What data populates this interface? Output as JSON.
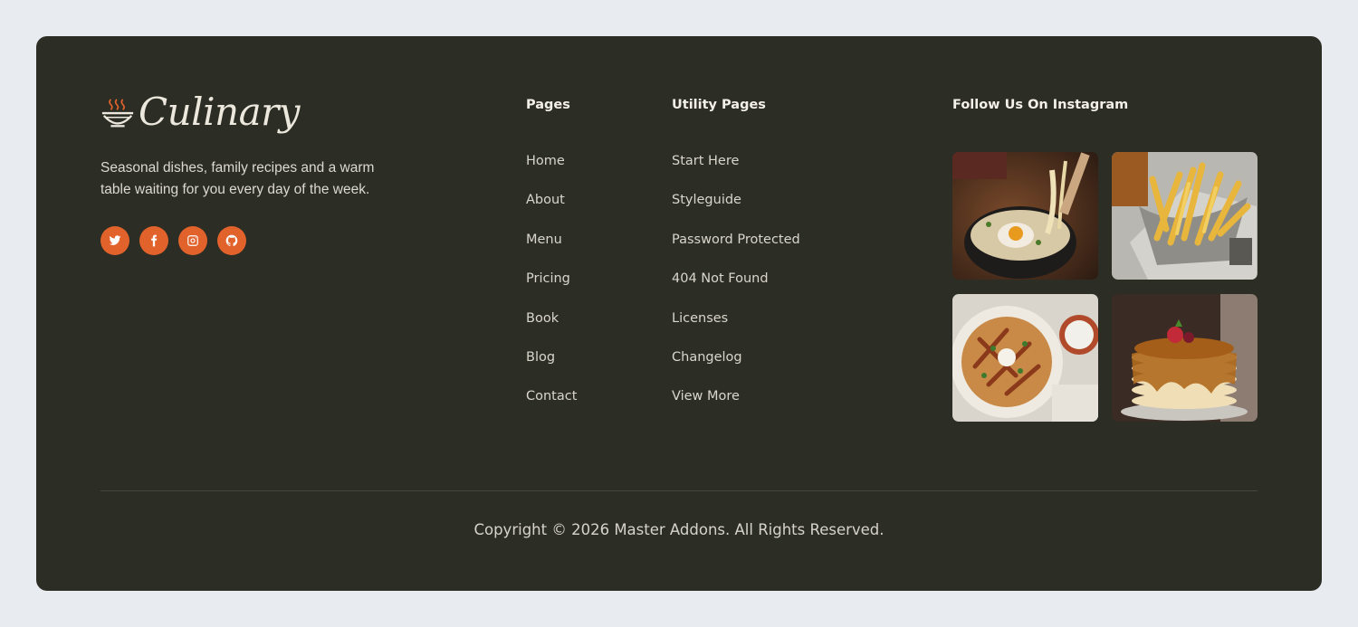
{
  "brand": {
    "name": "Culinary",
    "tagline": "Seasonal dishes, family recipes and a warm table waiting for you every day of the week."
  },
  "socials": [
    {
      "icon": "twitter-icon"
    },
    {
      "icon": "facebook-icon"
    },
    {
      "icon": "instagram-icon"
    },
    {
      "icon": "github-icon"
    }
  ],
  "pages": {
    "title": "Pages",
    "links": [
      "Home",
      "About",
      "Menu",
      "Pricing",
      "Book",
      "Blog",
      "Contact"
    ]
  },
  "utility": {
    "title": "Utility Pages",
    "links": [
      "Start Here",
      "Styleguide",
      "Password Protected",
      "404 Not Found",
      "Licenses",
      "Changelog",
      "View More"
    ]
  },
  "instagram": {
    "title": "Follow Us On Instagram"
  },
  "copyright": "Copyright © 2026 Master Addons. All Rights Reserved.",
  "colors": {
    "background": "#e8ebf0",
    "card": "#2c2d25",
    "accent": "#e1622b"
  }
}
